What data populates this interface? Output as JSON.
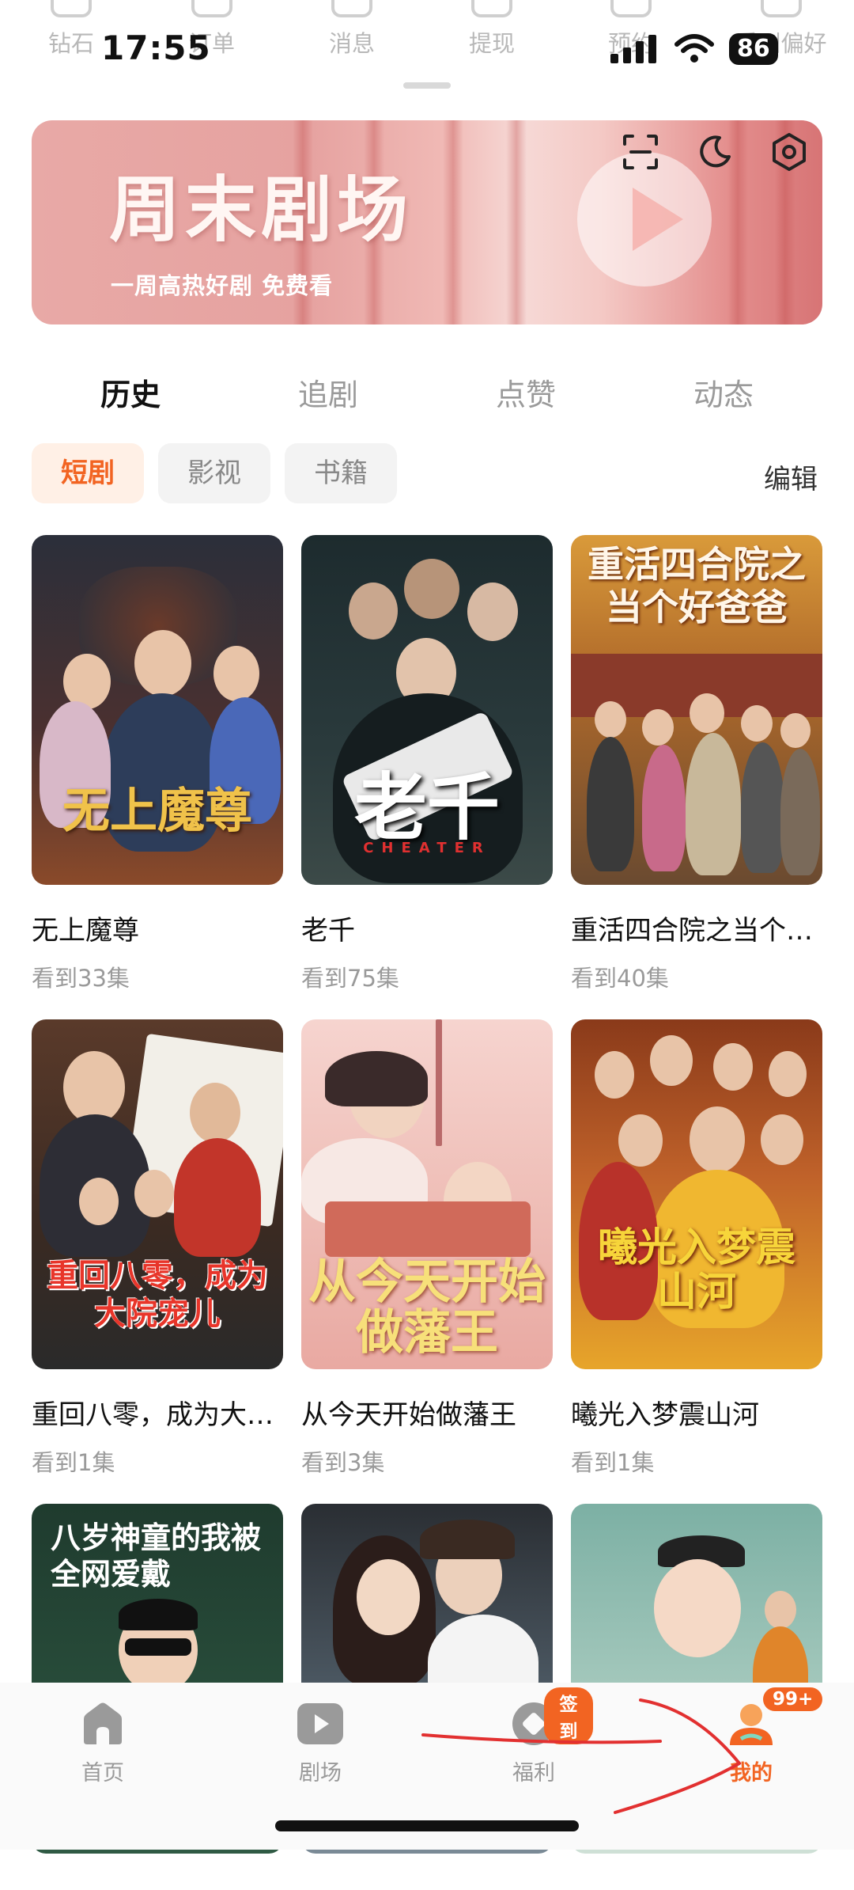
{
  "status_bar": {
    "time": "17:55",
    "battery": "86"
  },
  "top_menu": [
    "钻石",
    "订单",
    "消息",
    "提现",
    "预约",
    "看剧偏好"
  ],
  "banner": {
    "title": "周末剧场",
    "subtitle": "一周高热好剧 免费看"
  },
  "banner_tools": [
    "scan-icon",
    "moon-icon",
    "settings-icon"
  ],
  "tabs": [
    {
      "label": "历史"
    },
    {
      "label": "追剧"
    },
    {
      "label": "点赞"
    },
    {
      "label": "动态"
    }
  ],
  "active_tab": "历史",
  "filters": [
    {
      "label": "短剧"
    },
    {
      "label": "影视"
    },
    {
      "label": "书籍"
    }
  ],
  "active_filter": "短剧",
  "edit_label": "编辑",
  "shows": [
    {
      "title": "无上魔尊",
      "progress": "看到33集",
      "poster_text": "无上魔尊",
      "colors": [
        "#2b2f3a",
        "#8a4a2a"
      ]
    },
    {
      "title": "老千",
      "progress": "看到75集",
      "poster_text": "老千",
      "poster_sub": "CHEATER",
      "colors": [
        "#1d2b2e",
        "#3c4a48"
      ]
    },
    {
      "title": "重活四合院之当个…",
      "progress": "看到40集",
      "poster_text": "重活四合院之当个好爸爸",
      "colors": [
        "#c07a2a",
        "#6a4a30"
      ]
    },
    {
      "title": "重回八零，成为大…",
      "progress": "看到1集",
      "poster_text": "重回八零，成为大院宠儿",
      "colors": [
        "#5a3a2a",
        "#2a2a2a"
      ]
    },
    {
      "title": "从今天开始做藩王",
      "progress": "看到3集",
      "poster_text": "从今天开始做藩王",
      "colors": [
        "#f6d4cf",
        "#e9a9a2"
      ]
    },
    {
      "title": "曦光入梦震山河",
      "progress": "看到1集",
      "poster_text": "曦光入梦震山河",
      "colors": [
        "#8a3a1a",
        "#e7a52a"
      ]
    },
    {
      "title": "",
      "progress": "",
      "poster_text": "八岁神童的我被全网爱戴",
      "colors": [
        "#1f3b2e",
        "#2f5a44"
      ]
    },
    {
      "title": "",
      "progress": "",
      "poster_text": "",
      "colors": [
        "#2a2e33",
        "#7a8a96"
      ]
    },
    {
      "title": "",
      "progress": "",
      "poster_text": "",
      "colors": [
        "#7cb0a4",
        "#cfe0d6"
      ]
    }
  ],
  "bottom_nav": [
    {
      "label": "首页",
      "icon": "home-icon"
    },
    {
      "label": "剧场",
      "icon": "theater-play-icon"
    },
    {
      "label": "福利",
      "icon": "welfare-icon",
      "badge": "签到"
    },
    {
      "label": "我的",
      "icon": "profile-icon",
      "badge": "99+"
    }
  ],
  "active_nav": "我的",
  "accent_color": "#f26422"
}
